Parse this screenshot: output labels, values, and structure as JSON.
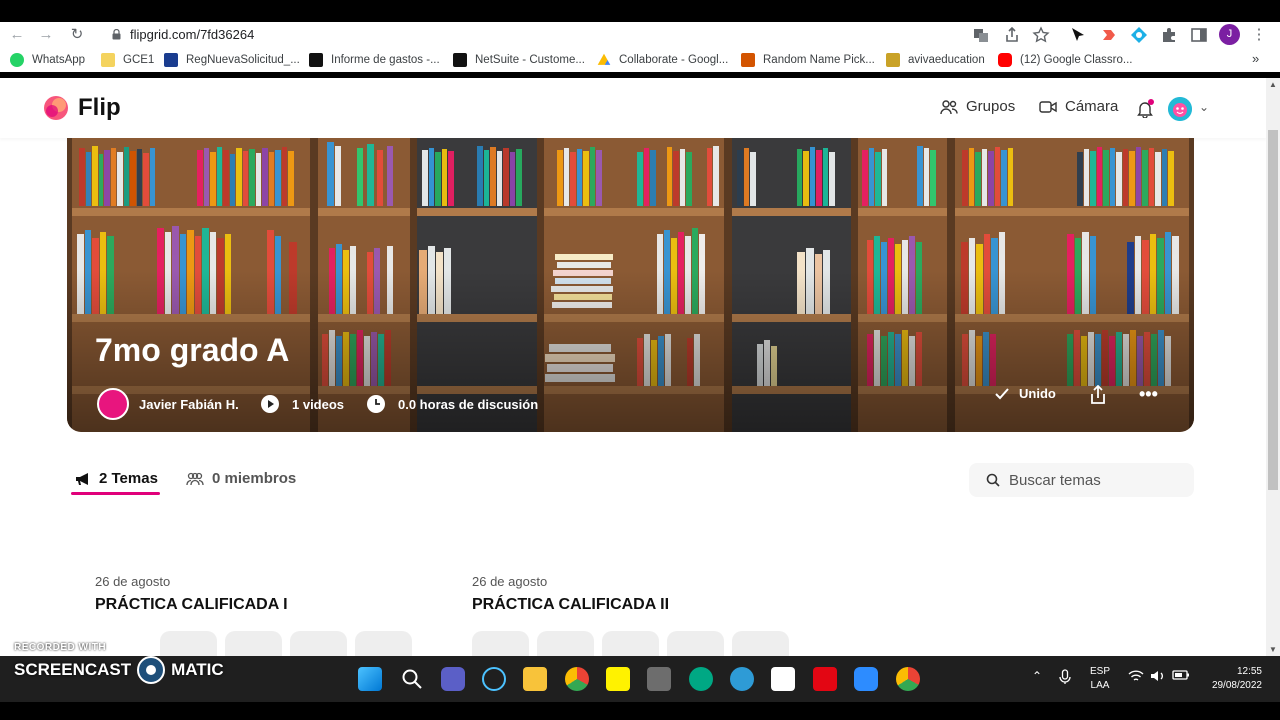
{
  "browser": {
    "url": "flipgrid.com/7fd36264",
    "profile_initial": "J"
  },
  "bookmarks": [
    {
      "label": "WhatsApp",
      "icon": "whatsapp-icon",
      "color": "#25d366"
    },
    {
      "label": "GCE1",
      "icon": "folder-icon",
      "color": "#f4d35e"
    },
    {
      "label": "RegNuevaSolicitud_...",
      "icon": "bookmark-icon",
      "color": "#1a3c8f"
    },
    {
      "label": "Informe de gastos -...",
      "icon": "netsuite-icon",
      "color": "#111111"
    },
    {
      "label": "NetSuite - Custome...",
      "icon": "netsuite-icon",
      "color": "#111111"
    },
    {
      "label": "Collaborate - Googl...",
      "icon": "google-drive-icon",
      "color": "#34a853"
    },
    {
      "label": "Random Name Pick...",
      "icon": "random-picker-icon",
      "color": "#d35400"
    },
    {
      "label": "avivaeducation",
      "icon": "aviva-icon",
      "color": "#c9a227"
    },
    {
      "label": "(12) Google Classro...",
      "icon": "youtube-icon",
      "color": "#ff0000"
    }
  ],
  "header": {
    "brand": "Flip",
    "nav_groups": "Grupos",
    "nav_camera": "Cámara"
  },
  "group": {
    "title": "7mo grado A",
    "owner": "Javier Fabián H.",
    "videos": "1 videos",
    "hours": "0.0 horas de discusión",
    "joined": "Unido"
  },
  "tabs": {
    "topics": "2 Temas",
    "members": "0 miembros"
  },
  "search": {
    "placeholder": "Buscar temas"
  },
  "topics": [
    {
      "date": "26 de agosto",
      "title": "PRÁCTICA CALIFICADA I"
    },
    {
      "date": "26 de agosto",
      "title": "PRÁCTICA CALIFICADA II"
    }
  ],
  "overlay": {
    "recorded": "RECORDED WITH",
    "brand_left": "SCREENCAST",
    "brand_right": "MATIC"
  },
  "taskbar": {
    "lang_1": "ESP",
    "lang_2": "LAA",
    "time": "12:55",
    "date": "29/08/2022"
  },
  "colors": {
    "accent": "#e0007a",
    "flip_logo": "#f7567c"
  }
}
